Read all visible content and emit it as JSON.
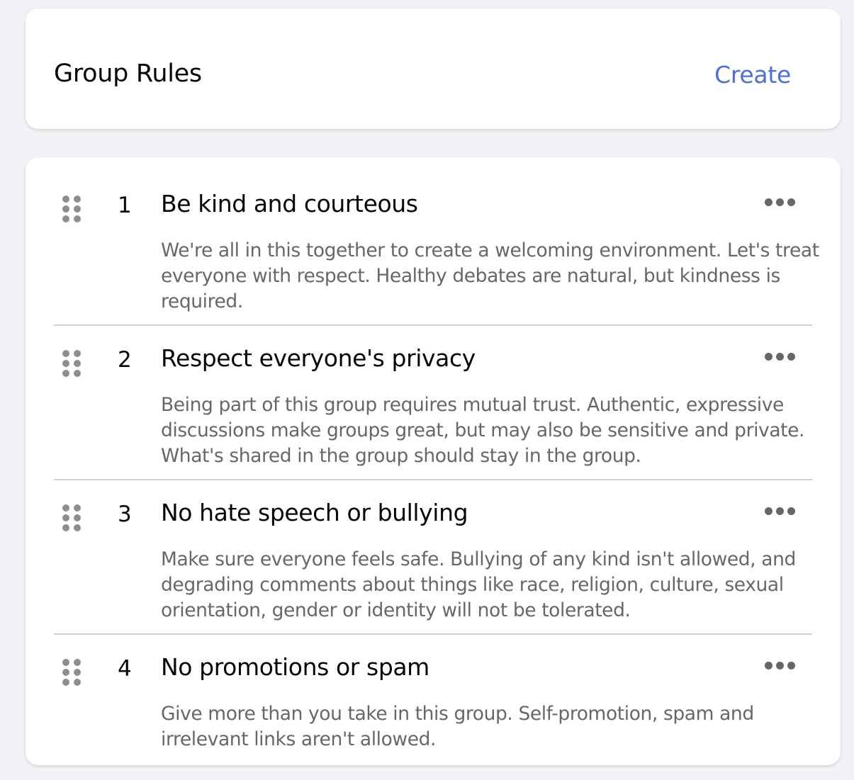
{
  "header": {
    "title": "Group Rules",
    "create_label": "Create",
    "accent_color": "#4b6fdb"
  },
  "rules": [
    {
      "number": "1",
      "title": "Be kind and courteous",
      "description": "We're all in this together to create a welcoming environment. Let's treat everyone with respect. Healthy debates are natural, but kindness is required."
    },
    {
      "number": "2",
      "title": "Respect everyone's privacy",
      "description": "Being part of this group requires mutual trust. Authentic, expressive discussions make groups great, but may also be sensitive and private. What's shared in the group should stay in the group."
    },
    {
      "number": "3",
      "title": "No hate speech or bullying",
      "description": "Make sure everyone feels safe. Bullying of any kind isn't allowed, and degrading comments about things like race, religion, culture, sexual orientation, gender or identity will not be tolerated."
    },
    {
      "number": "4",
      "title": "No promotions or spam",
      "description": "Give more than you take in this group. Self-promotion, spam and irrelevant links aren't allowed."
    }
  ],
  "icons": {
    "drag_handle": "drag-handle-icon",
    "more": "more-options-icon"
  }
}
